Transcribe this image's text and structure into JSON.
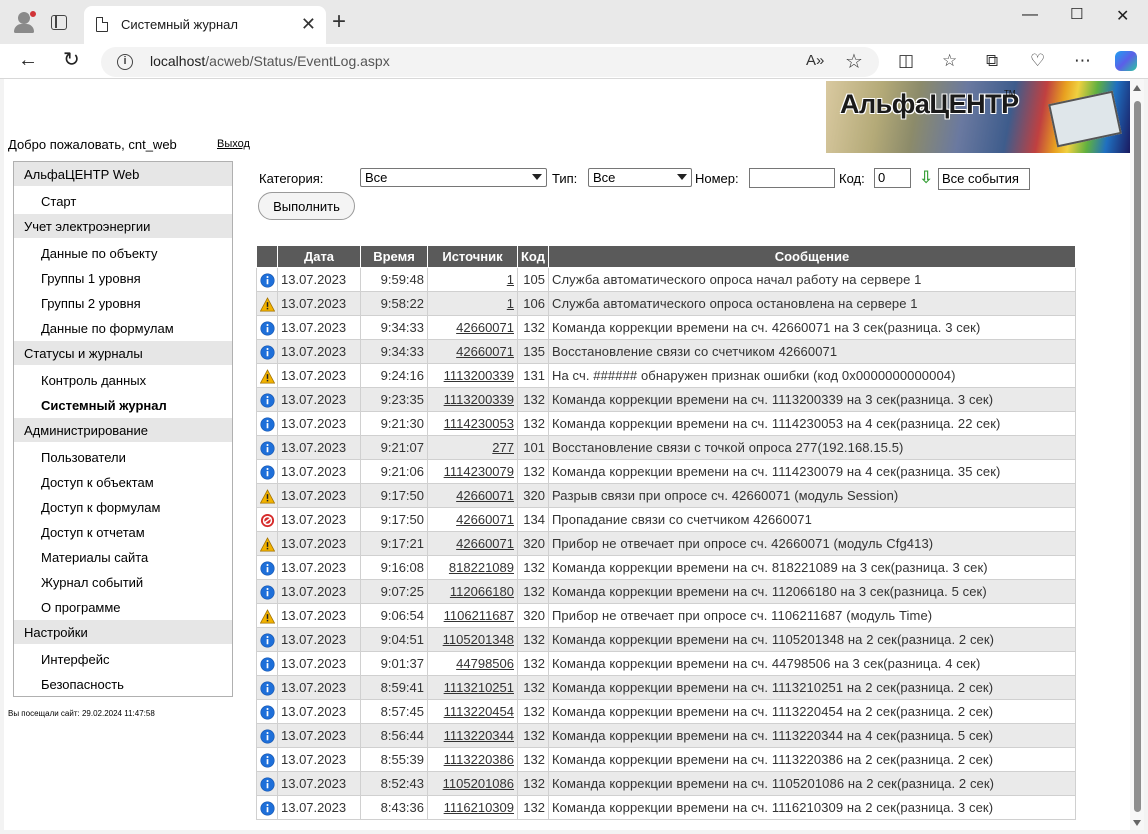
{
  "browser": {
    "tab_title": "Системный журнал",
    "url_host": "localhost",
    "url_path": "/acweb/Status/EventLog.aspx"
  },
  "header": {
    "logo_text": "АльфаЦЕНТР",
    "logo_tm": "TM",
    "welcome": "Добро пожаловать, cnt_web",
    "logout": "Выход"
  },
  "sidebar": {
    "groups": [
      {
        "title": "АльфаЦЕНТР Web",
        "items": [
          "Старт"
        ]
      },
      {
        "title": "Учет электроэнергии",
        "items": [
          "Данные по объекту",
          "Группы 1 уровня",
          "Группы 2 уровня",
          "Данные по формулам"
        ]
      },
      {
        "title": "Статусы и журналы",
        "items": [
          "Контроль данных",
          "Системный журнал"
        ]
      },
      {
        "title": "Администрирование",
        "items": [
          "Пользователи",
          "Доступ к объектам",
          "Доступ к формулам",
          "Доступ к отчетам",
          "Материалы сайта",
          "Журнал событий",
          "О программе"
        ]
      },
      {
        "title": "Настройки",
        "items": [
          "Интерфейс",
          "Безопасность"
        ]
      }
    ],
    "active_item": "Системный журнал",
    "visited": "Вы посещали сайт: 29.02.2024 11:47:58"
  },
  "filters": {
    "category_label": "Категория:",
    "category_value": "Все",
    "type_label": "Тип:",
    "type_value": "Все",
    "number_label": "Номер:",
    "number_value": "",
    "code_label": "Код:",
    "code_value": "0",
    "all_events": "Все события",
    "execute": "Выполнить"
  },
  "table": {
    "columns": [
      "Дата",
      "Время",
      "Источник",
      "Код",
      "Сообщение"
    ],
    "rows": [
      {
        "icon": "info",
        "date": "13.07.2023",
        "time": "9:59:48",
        "source": "1",
        "code": "105",
        "message": "Служба автоматического опроса начал работу на сервере 1"
      },
      {
        "icon": "warning",
        "date": "13.07.2023",
        "time": "9:58:22",
        "source": "1",
        "code": "106",
        "message": "Служба автоматического опроса остановлена на сервере 1"
      },
      {
        "icon": "info",
        "date": "13.07.2023",
        "time": "9:34:33",
        "source": "42660071",
        "code": "132",
        "message": "Команда коррекции времени на сч. 42660071 на 3 сек(разница. 3 сек)"
      },
      {
        "icon": "info",
        "date": "13.07.2023",
        "time": "9:34:33",
        "source": "42660071",
        "code": "135",
        "message": "Восстановление связи со счетчиком 42660071"
      },
      {
        "icon": "warning",
        "date": "13.07.2023",
        "time": "9:24:16",
        "source": "1113200339",
        "code": "131",
        "message": "На сч. ###### обнаружен признак ошибки (код 0x0000000000004)"
      },
      {
        "icon": "info",
        "date": "13.07.2023",
        "time": "9:23:35",
        "source": "1113200339",
        "code": "132",
        "message": "Команда коррекции времени на сч. 1113200339 на 3 сек(разница. 3 сек)"
      },
      {
        "icon": "info",
        "date": "13.07.2023",
        "time": "9:21:30",
        "source": "1114230053",
        "code": "132",
        "message": "Команда коррекции времени на сч. 1114230053 на 4 сек(разница. 22 сек)"
      },
      {
        "icon": "info",
        "date": "13.07.2023",
        "time": "9:21:07",
        "source": "277",
        "code": "101",
        "message": "Восстановление связи с точкой опроса 277(192.168.15.5)"
      },
      {
        "icon": "info",
        "date": "13.07.2023",
        "time": "9:21:06",
        "source": "1114230079",
        "code": "132",
        "message": "Команда коррекции времени на сч. 1114230079 на 4 сек(разница. 35 сек)"
      },
      {
        "icon": "warning",
        "date": "13.07.2023",
        "time": "9:17:50",
        "source": "42660071",
        "code": "320",
        "message": "Разрыв связи при опросе сч. 42660071 (модуль Session)"
      },
      {
        "icon": "error",
        "date": "13.07.2023",
        "time": "9:17:50",
        "source": "42660071",
        "code": "134",
        "message": "Пропадание связи со счетчиком 42660071"
      },
      {
        "icon": "warning",
        "date": "13.07.2023",
        "time": "9:17:21",
        "source": "42660071",
        "code": "320",
        "message": "Прибор не отвечает при опросе сч. 42660071 (модуль Cfg413)"
      },
      {
        "icon": "info",
        "date": "13.07.2023",
        "time": "9:16:08",
        "source": "818221089",
        "code": "132",
        "message": "Команда коррекции времени на сч. 818221089 на 3 сек(разница. 3 сек)"
      },
      {
        "icon": "info",
        "date": "13.07.2023",
        "time": "9:07:25",
        "source": "112066180",
        "code": "132",
        "message": "Команда коррекции времени на сч. 112066180 на 3 сек(разница. 5 сек)"
      },
      {
        "icon": "warning",
        "date": "13.07.2023",
        "time": "9:06:54",
        "source": "1106211687",
        "code": "320",
        "message": "Прибор не отвечает при опросе сч. 1106211687 (модуль Time)"
      },
      {
        "icon": "info",
        "date": "13.07.2023",
        "time": "9:04:51",
        "source": "1105201348",
        "code": "132",
        "message": "Команда коррекции времени на сч. 1105201348 на 2 сек(разница. 2 сек)"
      },
      {
        "icon": "info",
        "date": "13.07.2023",
        "time": "9:01:37",
        "source": "44798506",
        "code": "132",
        "message": "Команда коррекции времени на сч. 44798506 на 3 сек(разница. 4 сек)"
      },
      {
        "icon": "info",
        "date": "13.07.2023",
        "time": "8:59:41",
        "source": "1113210251",
        "code": "132",
        "message": "Команда коррекции времени на сч. 1113210251 на 2 сек(разница. 2 сек)"
      },
      {
        "icon": "info",
        "date": "13.07.2023",
        "time": "8:57:45",
        "source": "1113220454",
        "code": "132",
        "message": "Команда коррекции времени на сч. 1113220454 на 2 сек(разница. 2 сек)"
      },
      {
        "icon": "info",
        "date": "13.07.2023",
        "time": "8:56:44",
        "source": "1113220344",
        "code": "132",
        "message": "Команда коррекции времени на сч. 1113220344 на 4 сек(разница. 5 сек)"
      },
      {
        "icon": "info",
        "date": "13.07.2023",
        "time": "8:55:39",
        "source": "1113220386",
        "code": "132",
        "message": "Команда коррекции времени на сч. 1113220386 на 2 сек(разница. 2 сек)"
      },
      {
        "icon": "info",
        "date": "13.07.2023",
        "time": "8:52:43",
        "source": "1105201086",
        "code": "132",
        "message": "Команда коррекции времени на сч. 1105201086 на 2 сек(разница. 2 сек)"
      },
      {
        "icon": "info",
        "date": "13.07.2023",
        "time": "8:43:36",
        "source": "1116210309",
        "code": "132",
        "message": "Команда коррекции времени на сч. 1116210309 на 2 сек(разница. 3 сек)"
      }
    ]
  },
  "colors": {
    "header_bg": "#5a5a5a",
    "alt_row": "#eaeaea",
    "info": "#1e6fd9",
    "warning": "#f2b200",
    "error": "#d62b2b"
  }
}
